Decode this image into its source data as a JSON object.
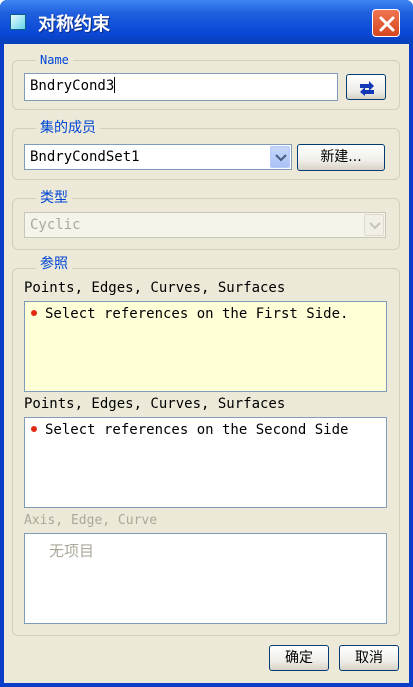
{
  "window": {
    "title": "对称约束"
  },
  "name_group": {
    "legend": "Name",
    "value": "BndryCond3"
  },
  "set_group": {
    "legend": "集的成员",
    "selected": "BndryCondSet1",
    "new_button": "新建..."
  },
  "type_group": {
    "legend": "类型",
    "selected": "Cyclic"
  },
  "refs_group": {
    "legend": "参照",
    "first_label": "Points, Edges, Curves, Surfaces",
    "first_item": "Select references on the First Side.",
    "second_label": "Points, Edges, Curves, Surfaces",
    "second_item": "Select references on the Second Side",
    "axis_label": "Axis, Edge, Curve",
    "axis_empty": "无项目"
  },
  "footer": {
    "ok": "确定",
    "cancel": "取消"
  },
  "icons": {
    "title": "dialog-icon",
    "close": "close-icon",
    "pick": "swap-arrows-icon",
    "dropdown": "chevron-down-icon",
    "bullet": "bullet-icon"
  },
  "colors": {
    "accent": "#0046d5",
    "title_bar": "#0a48d6",
    "bullet": "#e02a14"
  }
}
